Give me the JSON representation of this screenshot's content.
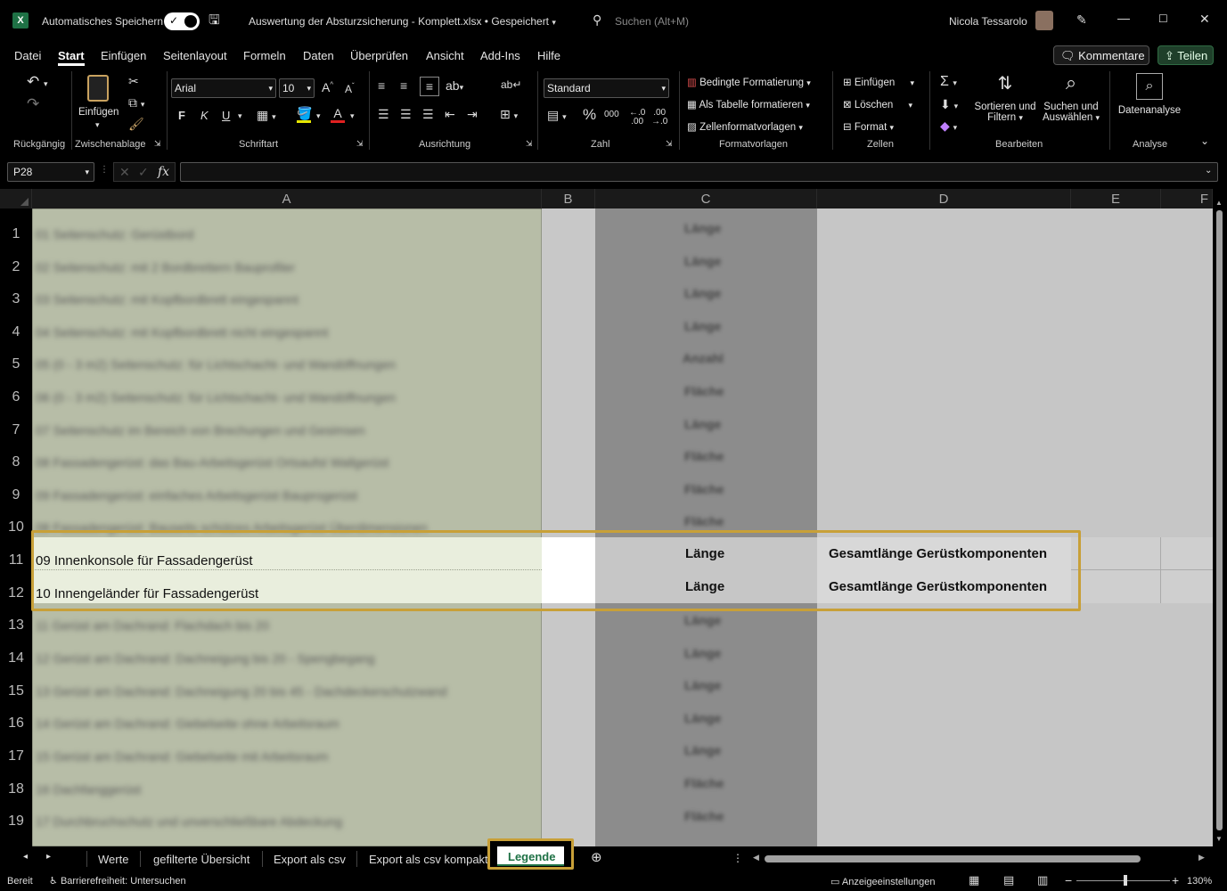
{
  "titlebar": {
    "autosave_label": "Automatisches Speichern",
    "doc_title": "Auswertung der Absturzsicherung - Komplett.xlsx • Gespeichert",
    "search_placeholder": "Suchen (Alt+M)",
    "user_name": "Nicola Tessarolo"
  },
  "menu": [
    "Datei",
    "Start",
    "Einfügen",
    "Seitenlayout",
    "Formeln",
    "Daten",
    "Überprüfen",
    "Ansicht",
    "Add-Ins",
    "Hilfe"
  ],
  "menu_active": "Start",
  "actions": {
    "comments": "Kommentare",
    "share": "Teilen"
  },
  "ribbon": {
    "groups": {
      "undo": "Rückgängig",
      "clipboard": "Zwischenablage",
      "font": "Schriftart",
      "alignment": "Ausrichtung",
      "number": "Zahl",
      "styles": "Formatvorlagen",
      "cells": "Zellen",
      "editing": "Bearbeiten",
      "analysis": "Analyse"
    },
    "paste": "Einfügen",
    "font_name": "Arial",
    "font_size": "10",
    "bold": "F",
    "italic": "K",
    "underline": "U",
    "number_format": "Standard",
    "conditional_formatting": "Bedingte Formatierung",
    "format_as_table": "Als Tabelle formatieren",
    "cell_styles": "Zellenformatvorlagen",
    "insert": "Einfügen",
    "delete": "Löschen",
    "format": "Format",
    "sort_filter_1": "Sortieren und",
    "sort_filter_2": "Filtern",
    "find_select_1": "Suchen und",
    "find_select_2": "Auswählen",
    "data_analysis": "Datenanalyse"
  },
  "formula_bar": {
    "name_box": "P28",
    "fx": "fx",
    "value": ""
  },
  "columns": [
    "A",
    "B",
    "C",
    "D",
    "E",
    "F"
  ],
  "rows": [
    "1",
    "2",
    "3",
    "4",
    "5",
    "6",
    "7",
    "8",
    "9",
    "10",
    "11",
    "12",
    "13",
    "14",
    "15",
    "16",
    "17",
    "18",
    "19"
  ],
  "blurred_rows": [
    {
      "a": "01 Seitenschutz: Gerüstbord",
      "c": "Länge"
    },
    {
      "a": "02 Seitenschutz: mit 2 Bordbrettern Bauprofiler",
      "c": "Länge"
    },
    {
      "a": "03 Seitenschutz: mit Kopfbordbrett eingespannt",
      "c": "Länge"
    },
    {
      "a": "04 Seitenschutz: mit Kopfbordbrett nicht eingespannt",
      "c": "Länge"
    },
    {
      "a": "05 (0 - 3 m2) Seitenschutz: für Lichtschacht- und Wandöffnungen",
      "c": "Anzahl"
    },
    {
      "a": "06 (0 - 3 m2) Seitenschutz: für Lichtschacht- und Wandöffnungen",
      "c": "Fläche"
    },
    {
      "a": "07 Seitenschutz im Bereich von Brechungen und Gesimsen",
      "c": "Länge"
    },
    {
      "a": "08 Fassadengerüst: das Bau-Arbeitsgerüst Ortsaufst Wallgerüst",
      "c": "Fläche"
    },
    {
      "a": "09 Fassadengerüst: einfaches Arbeitsgerüst Bauprogerüst",
      "c": "Fläche"
    },
    {
      "a": "08 Fassadengerüst: Bauseits schützes Arbeitsgerüst Überdimensionen",
      "c": "Fläche"
    }
  ],
  "highlight_rows": [
    {
      "a": "09 Innenkonsole für Fassadengerüst",
      "c": "Länge",
      "d": "Gesamtlänge Gerüstkomponenten"
    },
    {
      "a": "10 Innengeländer für Fassadengerüst",
      "c": "Länge",
      "d": "Gesamtlänge Gerüstkomponenten"
    }
  ],
  "blurred_rows_bottom": [
    {
      "a": "11 Gerüst am Dachrand: Flachdach bis 20",
      "c": "Länge"
    },
    {
      "a": "12 Gerüst am Dachrand: Dachneigung bis 20 - Spengbegang",
      "c": "Länge"
    },
    {
      "a": "13 Gerüst am Dachrand: Dachneigung 20 bis 45 - Dachdeckerschutzwand",
      "c": "Länge"
    },
    {
      "a": "14 Gerüst am Dachrand: Giebelseite ohne Arbeitsraum",
      "c": "Länge"
    },
    {
      "a": "15 Gerüst am Dachrand: Giebelseite mit Arbeitsraum",
      "c": "Länge"
    },
    {
      "a": "16 Dachfanggerüst",
      "c": "Fläche"
    },
    {
      "a": "17 Durchbruchschutz und unverschließbare Abdeckung",
      "c": "Fläche"
    }
  ],
  "sheet_tabs": [
    "Werte",
    "gefilterte Übersicht",
    "Export als csv",
    "Export als csv kompakt",
    "Legende"
  ],
  "active_sheet": "Legende",
  "status": {
    "ready": "Bereit",
    "accessibility": "Barrierefreiheit: Untersuchen",
    "display_settings": "Anzeigeeinstellungen",
    "zoom": "130%"
  },
  "colors": {
    "highlight_border": "#c8a038",
    "col_a_fill": "#b7bda7",
    "col_a_highlight": "#e9eedd",
    "col_c_fill": "#8c8c8c",
    "share_green": "#2f6b43",
    "accent_active_tab": "#1e7145"
  }
}
